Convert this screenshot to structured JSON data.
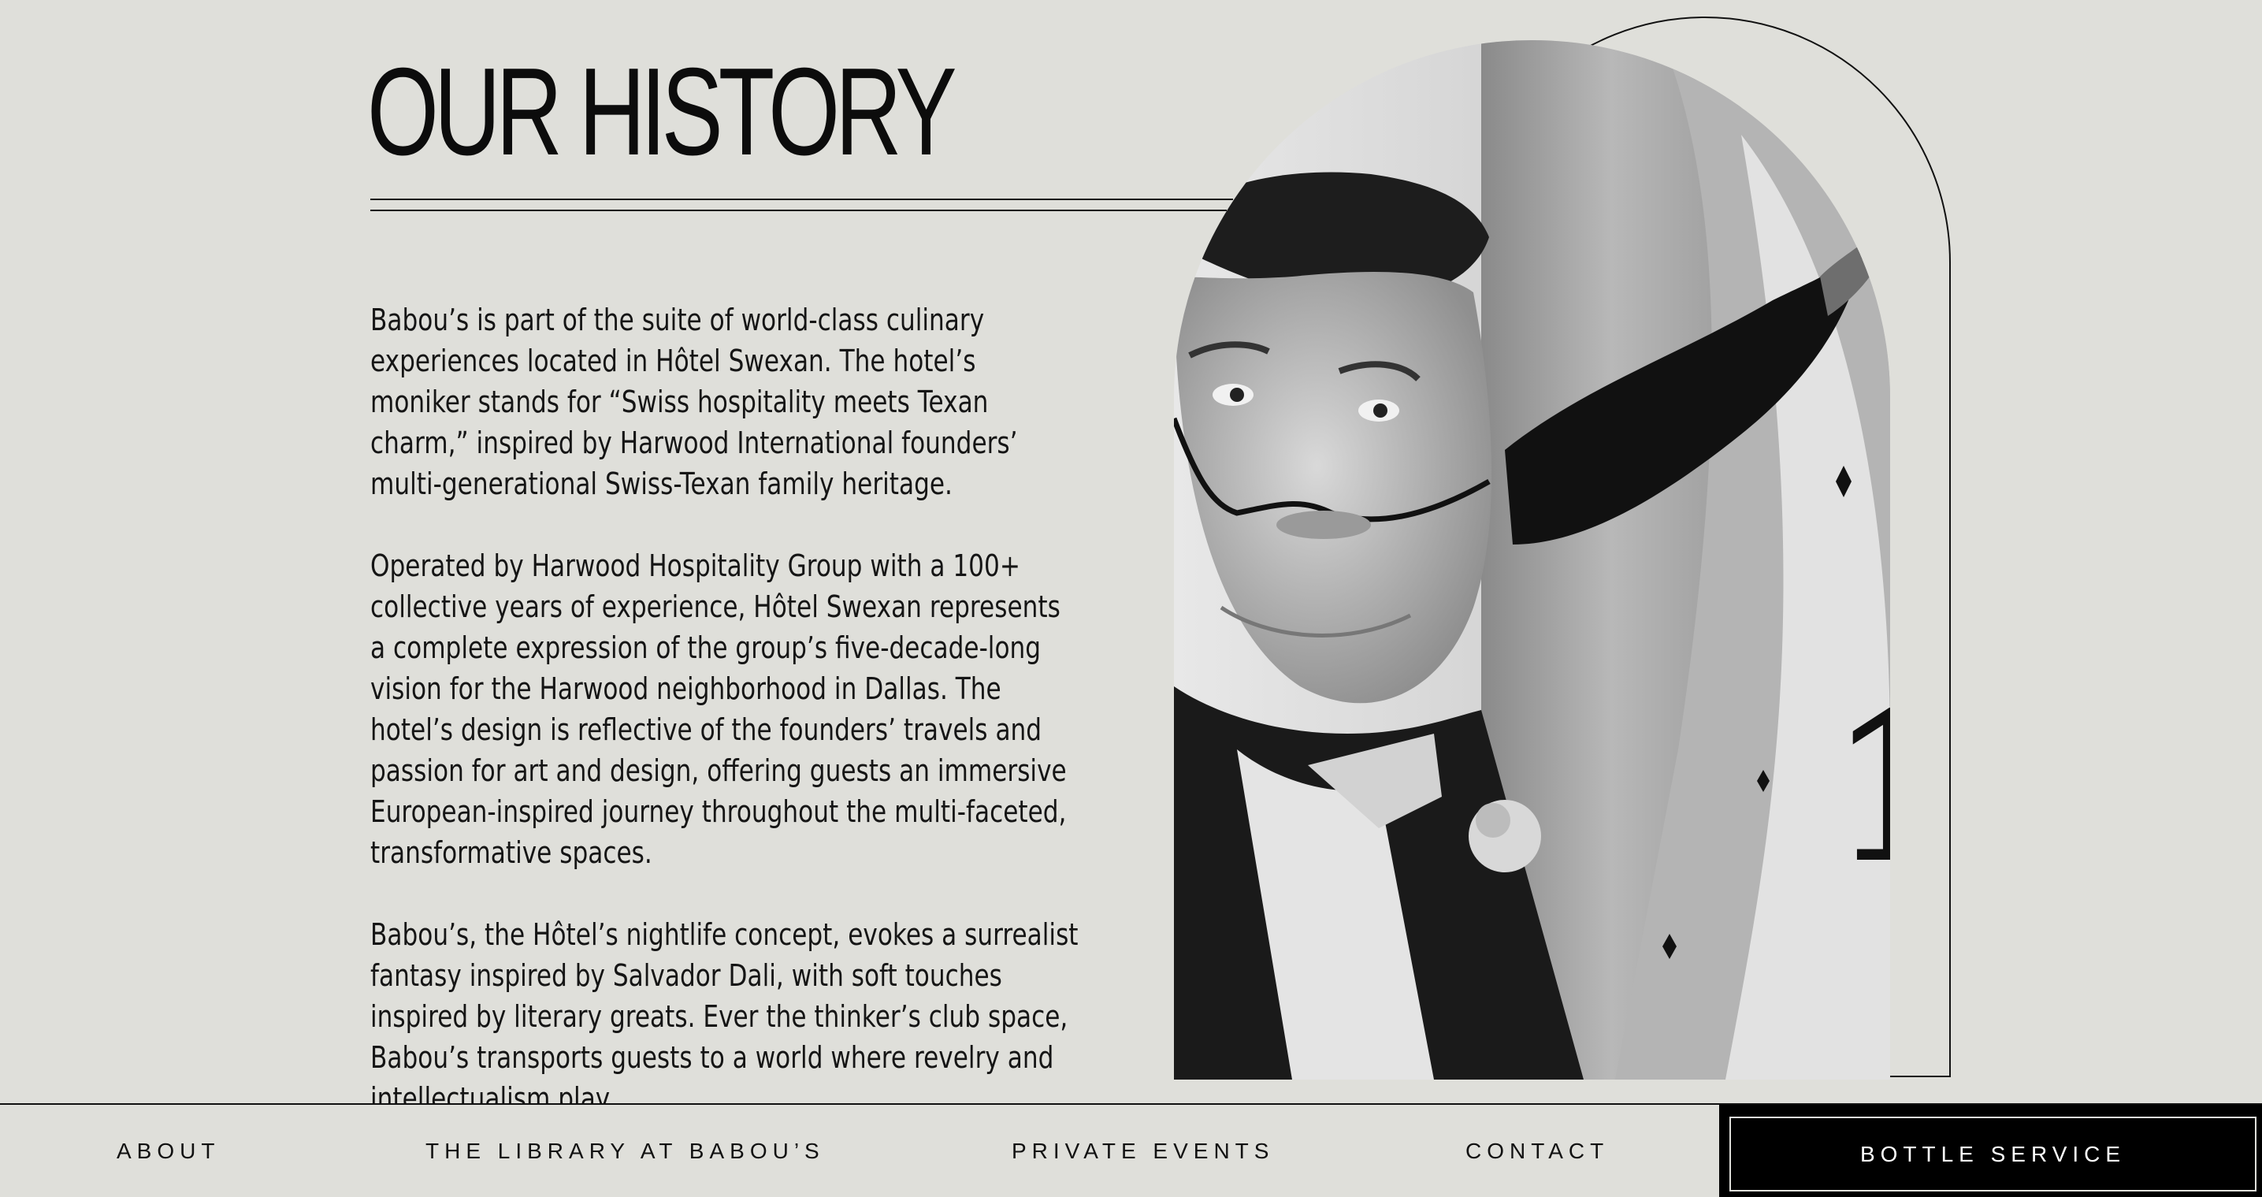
{
  "section": {
    "title": "OUR HISTORY",
    "paragraphs": [
      "Babou’s is part of the suite of world-class culinary experiences located in Hôtel Swexan. The hotel’s moniker stands for “Swiss hospitality meets Texan charm,” inspired by Harwood International founders’ multi-generational Swiss-Texan family heritage.",
      "Operated by Harwood Hospitality Group with a 100+ collective years of experience, Hôtel Swexan represents a complete expression of the group’s five-decade-long vision for the Harwood neighborhood in Dallas. The hotel’s design is reflective of the founders’ travels and passion for art and design, offering guests an immersive European-inspired journey throughout the multi-faceted, transformative spaces.",
      "Babou’s, the Hôtel’s nightlife concept, evokes a surrealist fantasy inspired by Salvador Dali, with soft touches inspired by literary greats. Ever the thinker’s club space, Babou’s transports guests to a world where revelry and intellectualism play."
    ],
    "image_alt": "Black and white photo of a Salvador Dali figure with a rooster and melting clock"
  },
  "nav": {
    "items": [
      "ABOUT",
      "THE LIBRARY AT BABOU’S",
      "PRIVATE EVENTS",
      "CONTACT"
    ],
    "cta": "BOTTLE SERVICE"
  },
  "colors": {
    "background": "#dfdfda",
    "text": "#0c0c0c",
    "cta_background": "#000000",
    "cta_text": "#ffffff"
  }
}
